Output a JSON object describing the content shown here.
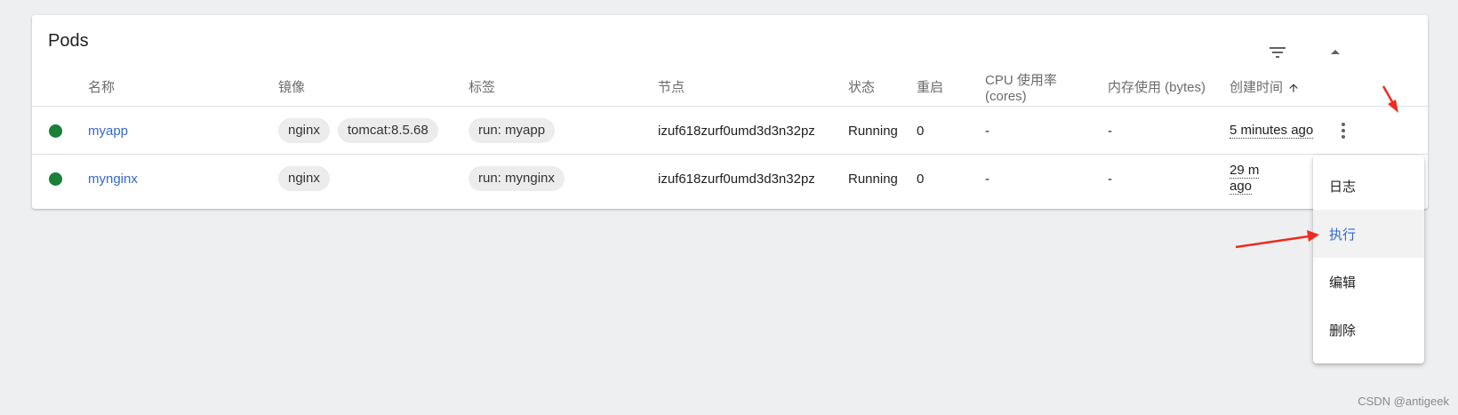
{
  "card": {
    "title": "Pods",
    "filter_icon": "filter-list-icon",
    "collapse_icon": "arrow-up-icon"
  },
  "columns": {
    "name": "名称",
    "images": "镜像",
    "labels": "标签",
    "node": "节点",
    "status": "状态",
    "restarts": "重启",
    "cpu_line1": "CPU 使用率",
    "cpu_line2": "(cores)",
    "memory": "内存使用 (bytes)",
    "created": "创建时间",
    "sort_icon": "arrow-up-sort-icon"
  },
  "rows": [
    {
      "status_color": "#188038",
      "name": "myapp",
      "images": [
        "nginx",
        "tomcat:8.5.68"
      ],
      "label": "run: myapp",
      "node": "izuf618zurf0umd3d3n32pz",
      "status": "Running",
      "restarts": "0",
      "cpu": "-",
      "memory": "-",
      "created": "5 minutes ago"
    },
    {
      "status_color": "#188038",
      "name": "mynginx",
      "images": [
        "nginx"
      ],
      "label": "run: mynginx",
      "node": "izuf618zurf0umd3d3n32pz",
      "status": "Running",
      "restarts": "0",
      "cpu": "-",
      "memory": "-",
      "created_line1": "29 m",
      "created_line2": "ago"
    }
  ],
  "menu": {
    "items": [
      "日志",
      "执行",
      "编辑",
      "删除"
    ],
    "active_index": 1
  },
  "colors": {
    "accent": "#3367d6",
    "status_ok": "#188038",
    "annotation": "#f02a1f"
  },
  "watermark": "CSDN @antigeek"
}
